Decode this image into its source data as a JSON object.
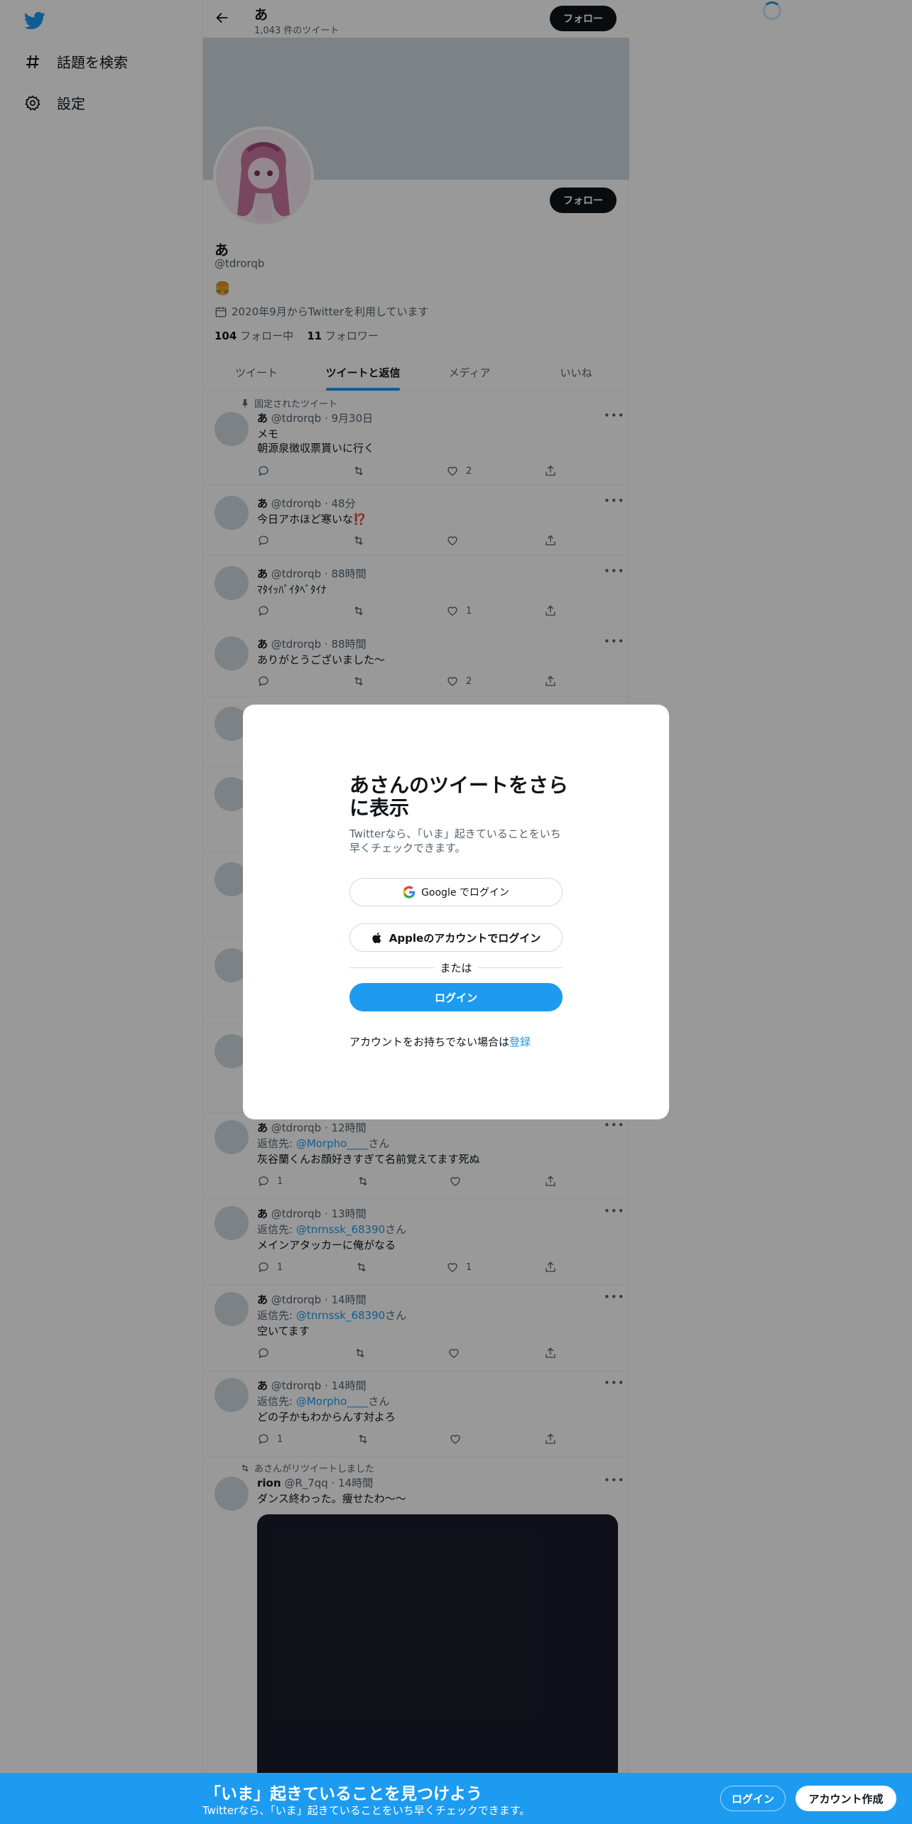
{
  "nav": {
    "explore_label": "話題を検索",
    "settings_label": "設定"
  },
  "header": {
    "name": "あ",
    "tweet_count": "1,043 件のツイート",
    "follow_label": "フォロー"
  },
  "profile": {
    "name": "あ",
    "handle": "@tdrorqb",
    "bio": "🍔",
    "joined": "2020年9月からTwitterを利用しています",
    "following_count": "104",
    "following_label": "フォロー中",
    "followers_count": "11",
    "followers_label": "フォロワー",
    "follow_label": "フォロー"
  },
  "tabs": [
    "ツイート",
    "ツイートと返信",
    "メディア",
    "いいね"
  ],
  "tweets": [
    {
      "context": "固定されたツイート",
      "name": "あ",
      "handle": "@tdrorqb",
      "time": "9月30日",
      "line1": "メモ",
      "line2": "朝源泉徴収票貰いに行く",
      "replies": "",
      "retweets": "",
      "likes": "2"
    },
    {
      "name": "あ",
      "handle": "@tdrorqb",
      "time": "48分",
      "line1": "今日アホほど寒いな⁉️",
      "replies": "",
      "retweets": "",
      "likes": ""
    },
    {
      "name": "あ",
      "handle": "@tdrorqb",
      "time": "88時間",
      "line1": "ﾏﾀｲｯﾊﾞｲﾀﾍﾞﾀｲﾅ",
      "replies": "",
      "retweets": "",
      "likes": "1"
    },
    {
      "name": "あ",
      "handle": "@tdrorqb",
      "time": "88時間",
      "line1": "ありがとうございました〜",
      "replies": "",
      "retweets": "",
      "likes": "2"
    },
    {
      "name": "あ",
      "handle": "@tdrorqb",
      "time": "12時間",
      "reply_prefix": "返信先: ",
      "reply_to": "@Morpho____",
      "reply_suffix": "さん",
      "line1": "灰谷蘭くんお顔好きすぎて名前覚えてます死ぬ",
      "replies": "1",
      "retweets": "",
      "likes": ""
    },
    {
      "name": "あ",
      "handle": "@tdrorqb",
      "time": "13時間",
      "reply_prefix": "返信先: ",
      "reply_to": "@tnrnssk_68390",
      "reply_suffix": "さん",
      "line1": "メインアタッカーに俺がなる",
      "replies": "1",
      "retweets": "",
      "likes": "1"
    },
    {
      "name": "あ",
      "handle": "@tdrorqb",
      "time": "14時間",
      "reply_prefix": "返信先: ",
      "reply_to": "@tnrnssk_68390",
      "reply_suffix": "さん",
      "line1": "空いてます",
      "replies": "",
      "retweets": "",
      "likes": ""
    },
    {
      "name": "あ",
      "handle": "@tdrorqb",
      "time": "14時間",
      "reply_prefix": "返信先: ",
      "reply_to": "@Morpho____",
      "reply_suffix": "さん",
      "line1": "どの子かもわからんす対よろ",
      "replies": "1",
      "retweets": "",
      "likes": ""
    },
    {
      "context": "あさんがリツイートしました",
      "name": "rion",
      "handle": "@R_7qq",
      "time": "14時間",
      "line1": "ダンス終わった。痩せたわ〜〜"
    }
  ],
  "modal": {
    "title": "あさんのツイートをさらに表示",
    "subtitle": "Twitterなら、「いま」起きていることをいち早くチェックできます。",
    "google_label": "Google でログイン",
    "apple_label": "Appleのアカウントでログイン",
    "or_label": "または",
    "login_label": "ログイン",
    "signup_prefix": "アカウントをお持ちでない場合は",
    "signup_link": "登録"
  },
  "bottom_bar": {
    "headline": "「いま」起きていることを見つけよう",
    "sub": "Twitterなら、「いま」起きていることをいち早くチェックできます。",
    "login_label": "ログイン",
    "signup_label": "アカウント作成"
  },
  "colors": {
    "accent": "#1d9bf0",
    "text": "#0f1419",
    "secondary": "#536471"
  }
}
